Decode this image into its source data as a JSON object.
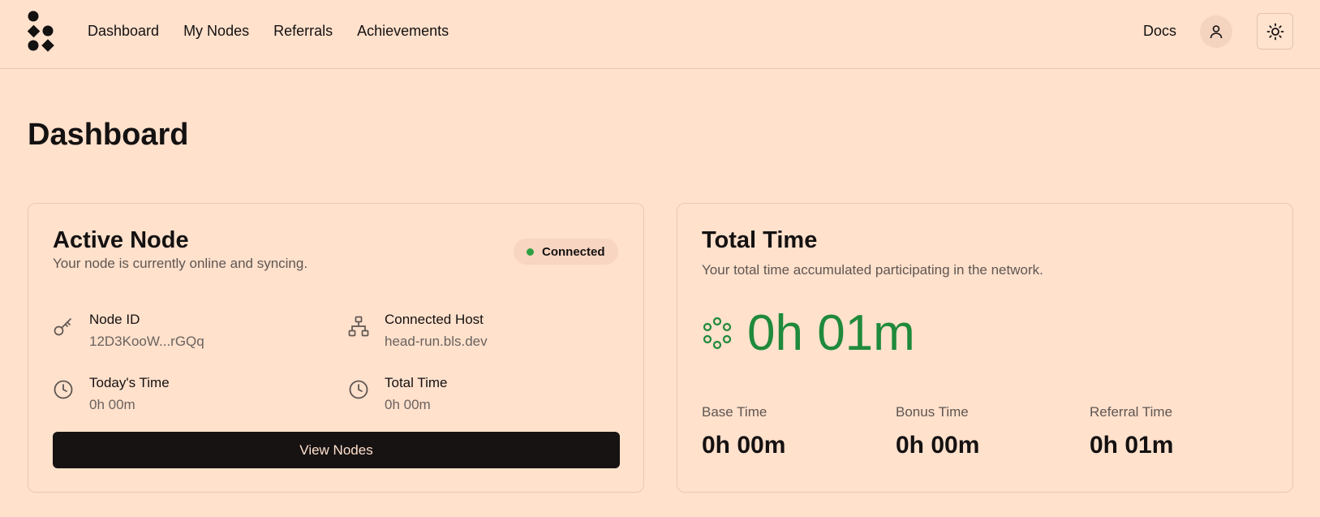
{
  "header": {
    "nav": [
      "Dashboard",
      "My Nodes",
      "Referrals",
      "Achievements"
    ],
    "docs_label": "Docs",
    "icons": {
      "logo": "blockless-logo",
      "user": "user-icon",
      "theme": "sun-icon"
    }
  },
  "page": {
    "title": "Dashboard"
  },
  "active_node": {
    "title": "Active Node",
    "subtitle": "Your node is currently online and syncing.",
    "status": "Connected",
    "status_color": "#2ea043",
    "node_id": {
      "label": "Node ID",
      "value": "12D3KooW...rGQq",
      "icon": "key-icon"
    },
    "host": {
      "label": "Connected Host",
      "value": "head-run.bls.dev",
      "icon": "network-icon"
    },
    "today": {
      "label": "Today's Time",
      "value": "0h 00m",
      "icon": "clock-icon"
    },
    "total": {
      "label": "Total Time",
      "value": "0h 00m",
      "icon": "clock-icon"
    },
    "button_label": "View Nodes"
  },
  "total_time": {
    "title": "Total Time",
    "subtitle": "Your total time accumulated participating in the network.",
    "value": "0h 01m",
    "accent_color": "#1f8a3b",
    "base": {
      "label": "Base Time",
      "value": "0h 00m"
    },
    "bonus": {
      "label": "Bonus Time",
      "value": "0h 00m"
    },
    "referral": {
      "label": "Referral Time",
      "value": "0h 01m"
    }
  }
}
